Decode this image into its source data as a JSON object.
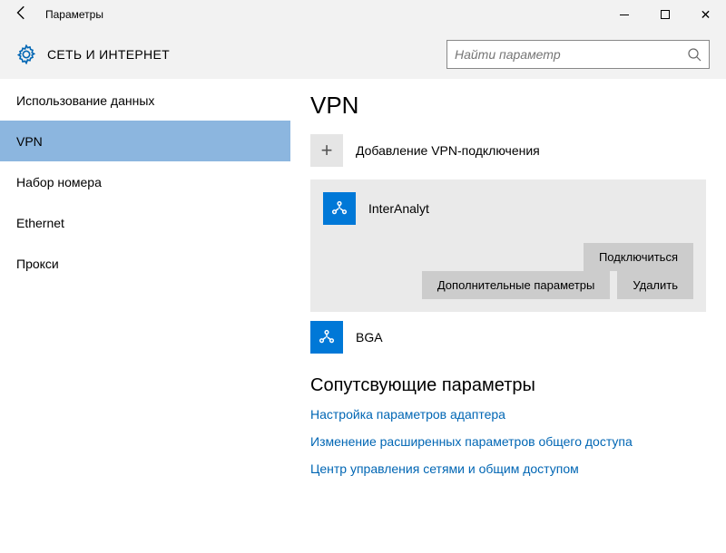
{
  "titlebar": {
    "title": "Параметры"
  },
  "header": {
    "category": "СЕТЬ И ИНТЕРНЕТ",
    "search_placeholder": "Найти параметр"
  },
  "sidebar": {
    "items": [
      {
        "label": "Использование данных",
        "selected": false
      },
      {
        "label": "VPN",
        "selected": true
      },
      {
        "label": "Набор номера",
        "selected": false
      },
      {
        "label": "Ethernet",
        "selected": false
      },
      {
        "label": "Прокси",
        "selected": false
      }
    ]
  },
  "main": {
    "heading": "VPN",
    "add_label": "Добавление VPN-подключения",
    "connections": [
      {
        "name": "InterAnalyt",
        "expanded": true,
        "connect_label": "Подключиться",
        "advanced_label": "Дополнительные параметры",
        "delete_label": "Удалить"
      },
      {
        "name": "BGA",
        "expanded": false
      }
    ],
    "related_heading": "Сопутсвующие параметры",
    "links": [
      "Настройка параметров адаптера",
      "Изменение расширенных параметров общего доступа",
      "Центр управления сетями и общим доступом"
    ]
  }
}
